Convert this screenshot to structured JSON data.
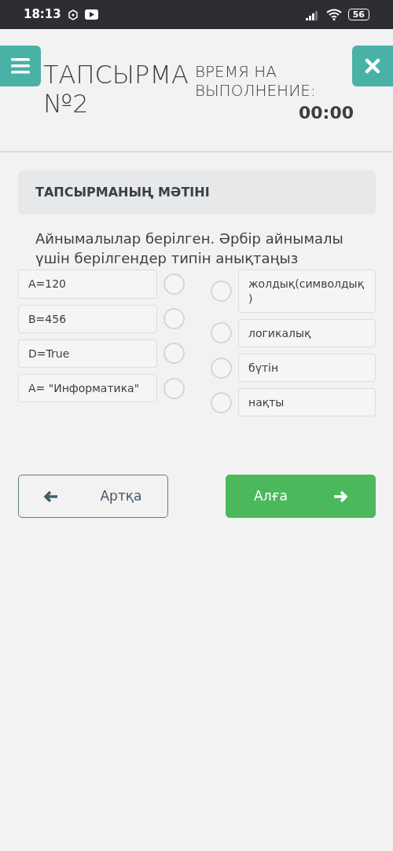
{
  "status_bar": {
    "time": "18:13",
    "battery": "56"
  },
  "header": {
    "title": "ТАПСЫРМА №2",
    "timer_label": "ВРЕМЯ НА ВЫПОЛНЕНИЕ:",
    "timer_value": "00:00"
  },
  "task": {
    "heading": "ТАПСЫРМАНЫҢ МӘТІНІ",
    "question": "Айнымалылар берілген. Әрбір айнымалы үшін берілгендер типін анықтаңыз",
    "left_items": [
      {
        "label": "A=120",
        "selected": false
      },
      {
        "label": "B=456",
        "selected": false
      },
      {
        "label": "D=True",
        "selected": false
      },
      {
        "label": "A= \"Информатика\"",
        "selected": false
      }
    ],
    "right_items": [
      {
        "label": "жолдық(символдық)",
        "selected": false
      },
      {
        "label": "логикалық",
        "selected": false
      },
      {
        "label": "бүтін",
        "selected": false
      },
      {
        "label": "нақты",
        "selected": false
      }
    ]
  },
  "buttons": {
    "back": "Артқа",
    "forward": "Алға"
  }
}
